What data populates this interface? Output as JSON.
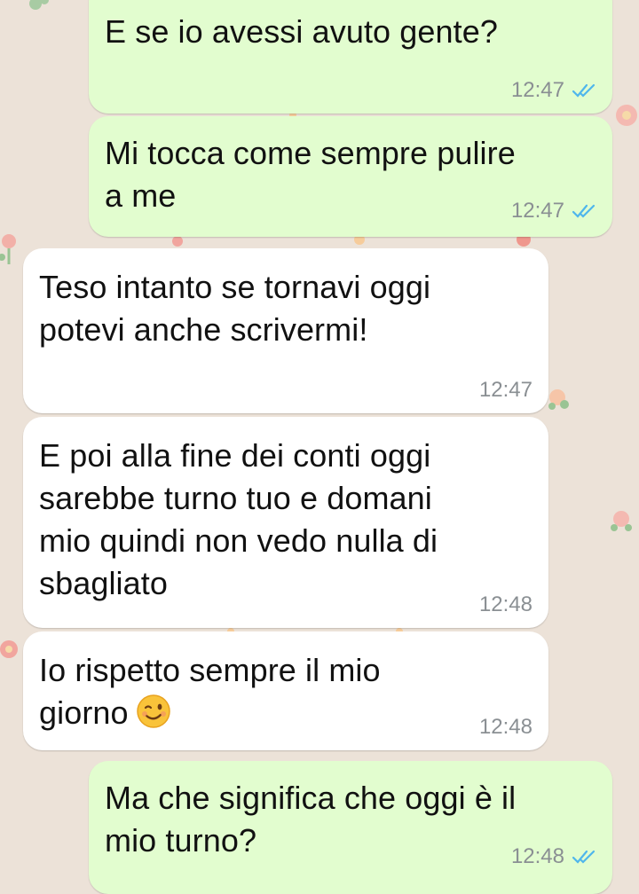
{
  "colors": {
    "background": "#ece2d8",
    "outgoing_bubble": "#e2fdcf",
    "incoming_bubble": "#ffffff",
    "timestamp": "#8a8f93",
    "read_ticks": "#4fb6ec"
  },
  "messages": [
    {
      "direction": "outgoing",
      "text": "E se io avessi avuto gente?",
      "time": "12:47",
      "status_icon": "double-check-read-icon"
    },
    {
      "direction": "outgoing",
      "text": "Mi tocca come sempre pulire\na me",
      "time": "12:47",
      "status_icon": "double-check-read-icon"
    },
    {
      "direction": "incoming",
      "text": "Teso intanto se tornavi oggi\npotevi anche scrivermi!",
      "time": "12:47"
    },
    {
      "direction": "incoming",
      "text": "E poi alla fine dei conti oggi\nsarebbe turno tuo e domani\nmio quindi non vedo nulla di\nsbagliato",
      "time": "12:48"
    },
    {
      "direction": "incoming",
      "text": "Io rispetto sempre il mio\ngiorno",
      "emoji": "winking-face-emoji",
      "time": "12:48"
    },
    {
      "direction": "outgoing",
      "text": "Ma che significa che oggi è il\nmio turno?",
      "time": "12:48",
      "status_icon": "double-check-read-icon"
    }
  ]
}
